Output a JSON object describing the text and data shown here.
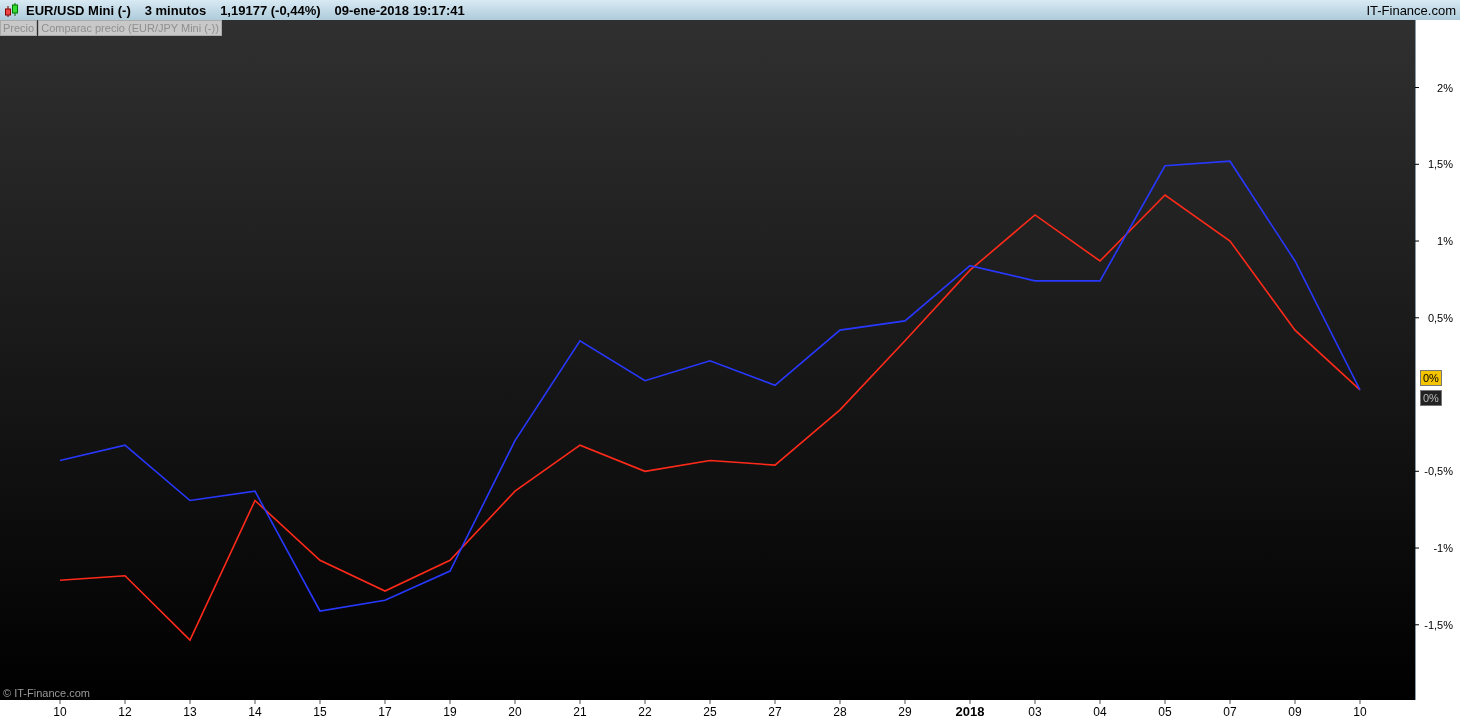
{
  "title_bar": {
    "instrument": "EUR/USD Mini (-)",
    "interval": "3 minutos",
    "quote": "1,19177 (-0,44%)",
    "datetime": "09-ene-2018 19:17:41",
    "brand": "IT-Finance.com"
  },
  "legend": [
    {
      "label": "Precio"
    },
    {
      "label": "Comparac precio (EUR/JPY Mini (-))"
    }
  ],
  "chart": {
    "watermark": "© IT-Finance.com",
    "price_labels": [
      {
        "text": "0%",
        "kind": "current"
      },
      {
        "text": "0%",
        "kind": "compare"
      }
    ],
    "chart_data": {
      "type": "line",
      "categories": [
        "10",
        "12",
        "13",
        "14",
        "15",
        "17",
        "19",
        "20",
        "21",
        "22",
        "25",
        "27",
        "28",
        "29",
        "2018",
        "03",
        "04",
        "05",
        "07",
        "09",
        "10"
      ],
      "ylim": [
        -1.99,
        2.44
      ],
      "series": [
        {
          "color": "#ff2a1a",
          "values": [
            -1.21,
            -1.18,
            -1.6,
            -0.69,
            -1.08,
            -1.28,
            -1.08,
            -0.63,
            -0.33,
            -0.5,
            -0.43,
            -0.46,
            -0.1,
            0.35,
            0.81,
            1.17,
            0.87,
            1.3,
            1.0,
            0.42,
            0.03
          ]
        },
        {
          "color": "#2838ff",
          "values": [
            -0.43,
            -0.33,
            -0.69,
            -0.63,
            -1.41,
            -1.34,
            -1.15,
            -0.3,
            0.35,
            0.09,
            0.22,
            0.06,
            0.42,
            0.48,
            0.84,
            0.74,
            0.74,
            1.49,
            1.52,
            0.87,
            0.03
          ]
        }
      ],
      "yticks": [
        {
          "value": 2,
          "label": "2%"
        },
        {
          "value": 1.5,
          "label": "1,5%"
        },
        {
          "value": 1,
          "label": "1%"
        },
        {
          "value": 0.5,
          "label": "0,5%"
        },
        {
          "value": -0.5,
          "label": "-0,5%"
        },
        {
          "value": -1,
          "label": "-1%"
        },
        {
          "value": -1.5,
          "label": "-1,5%"
        }
      ]
    }
  }
}
